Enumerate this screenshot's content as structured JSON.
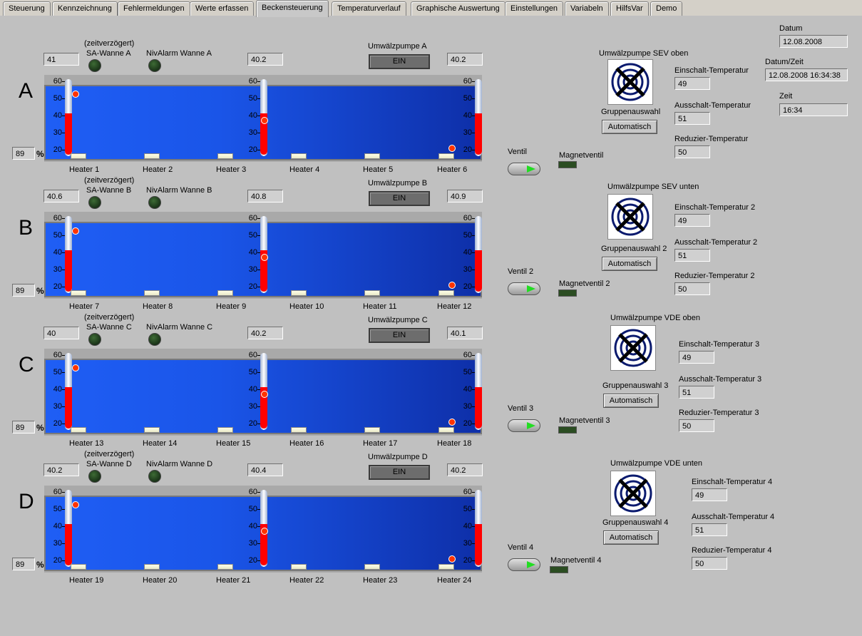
{
  "tabs": [
    "Steuerung",
    "Kennzeichnung",
    "Fehlermeldungen",
    "Werte erfassen",
    "Beckensteuerung",
    "Temperaturverlauf",
    "Graphische Auswertung",
    "Einstellungen",
    "Variabeln",
    "HilfsVar",
    "Demo"
  ],
  "active_tab": "Beckensteuerung",
  "datetime": {
    "datum_label": "Datum",
    "datum_value": "12.08.2008",
    "datumzeit_label": "Datum/Zeit",
    "datumzeit_value": "12.08.2008 16:34:38",
    "zeit_label": "Zeit",
    "zeit_value": "16:34"
  },
  "scale_ticks": [
    "60",
    "50",
    "40",
    "30",
    "20"
  ],
  "tanks": [
    {
      "letter": "A",
      "left_value": "41",
      "sa_delay_label": "(zeitverzögert)",
      "sa_label": "SA-Wanne A",
      "nivalarm_label": "NivAlarm Wanne A",
      "mid_value": "40.2",
      "pump_label": "Umwälzpumpe A",
      "pump_button": "EIN",
      "right_value": "40.2",
      "level_value": "89",
      "pct": "%",
      "heaters": [
        "Heater 1",
        "Heater 2",
        "Heater 3",
        "Heater 4",
        "Heater 5",
        "Heater 6"
      ],
      "thermo_values": [
        40,
        40,
        40
      ],
      "fan_title": "Umwälzpumpe SEV oben",
      "group_label": "Gruppenauswahl",
      "group_button": "Automatisch",
      "ein_label": "Einschalt-Temperatur",
      "ein_value": "49",
      "aus_label": "Ausschalt-Temperatur",
      "aus_value": "51",
      "red_label": "Reduzier-Temperatur",
      "red_value": "50",
      "ventil_label": "Ventil",
      "magnet_label": "Magnetventil"
    },
    {
      "letter": "B",
      "left_value": "40.6",
      "sa_delay_label": "(zeitverzögert)",
      "sa_label": "SA-Wanne B",
      "nivalarm_label": "NivAlarm Wanne B",
      "mid_value": "40.8",
      "pump_label": "Umwälzpumpe B",
      "pump_button": "EIN",
      "right_value": "40.9",
      "level_value": "89",
      "pct": "%",
      "heaters": [
        "Heater 7",
        "Heater 8",
        "Heater 9",
        "Heater 10",
        "Heater 11",
        "Heater 12"
      ],
      "thermo_values": [
        40,
        40,
        40
      ],
      "fan_title": "Umwälzpumpe SEV unten",
      "group_label": "Gruppenauswahl 2",
      "group_button": "Automatisch",
      "ein_label": "Einschalt-Temperatur 2",
      "ein_value": "49",
      "aus_label": "Ausschalt-Temperatur 2",
      "aus_value": "51",
      "red_label": "Reduzier-Temperatur 2",
      "red_value": "50",
      "ventil_label": "Ventil 2",
      "magnet_label": "Magnetventil 2"
    },
    {
      "letter": "C",
      "left_value": "40",
      "sa_delay_label": "(zeitverzögert)",
      "sa_label": "SA-Wanne C",
      "nivalarm_label": "NivAlarm Wanne C",
      "mid_value": "40.2",
      "pump_label": "Umwälzpumpe C",
      "pump_button": "EIN",
      "right_value": "40.1",
      "level_value": "89",
      "pct": "%",
      "heaters": [
        "Heater 13",
        "Heater 14",
        "Heater 15",
        "Heater 16",
        "Heater 17",
        "Heater 18"
      ],
      "thermo_values": [
        40,
        40,
        40
      ],
      "fan_title": "Umwälzpumpe VDE oben",
      "group_label": "Gruppenauswahl 3",
      "group_button": "Automatisch",
      "ein_label": "Einschalt-Temperatur 3",
      "ein_value": "49",
      "aus_label": "Ausschalt-Temperatur 3",
      "aus_value": "51",
      "red_label": "Reduzier-Temperatur 3",
      "red_value": "50",
      "ventil_label": "Ventil 3",
      "magnet_label": "Magnetventil 3"
    },
    {
      "letter": "D",
      "left_value": "40.2",
      "sa_delay_label": "(zeitverzögert)",
      "sa_label": "SA-Wanne D",
      "nivalarm_label": "NivAlarm Wanne D",
      "mid_value": "40.4",
      "pump_label": "Umwälzpumpe D",
      "pump_button": "EIN",
      "right_value": "40.2",
      "level_value": "89",
      "pct": "%",
      "heaters": [
        "Heater 19",
        "Heater 20",
        "Heater 21",
        "Heater 22",
        "Heater 23",
        "Heater 24"
      ],
      "thermo_values": [
        40,
        40,
        40
      ],
      "fan_title": "Umwälzpumpe VDE unten",
      "group_label": "Gruppenauswahl 4",
      "group_button": "Automatisch",
      "ein_label": "Einschalt-Temperatur 4",
      "ein_value": "49",
      "aus_label": "Ausschalt-Temperatur 4",
      "aus_value": "51",
      "red_label": "Reduzier-Temperatur 4",
      "red_value": "50",
      "ventil_label": "Ventil 4",
      "magnet_label": "Magnetventil 4"
    }
  ],
  "colors": {
    "water_light": "#1f5ef5",
    "water_dark": "#0e2fa8",
    "thermo_fill": "#ff0000",
    "valve_arrow": "#22dd22",
    "led_off": "#2b4d22"
  }
}
